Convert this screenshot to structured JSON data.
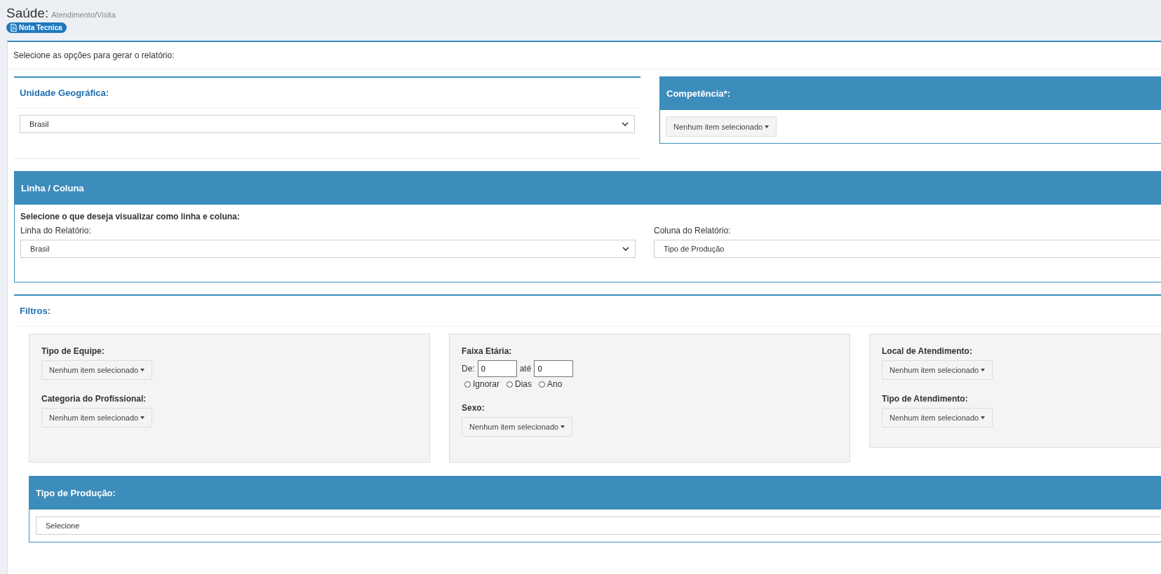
{
  "page_header": {
    "title": "Saúde:",
    "subtitle": "Atendimento/Visita",
    "badge": "Nota Tecnica"
  },
  "intro": "Selecione as opções para gerar o relatório:",
  "unidade": {
    "title": "Unidade Geográfica:",
    "value": "Brasil"
  },
  "competencia": {
    "title": "Competência*:",
    "dropdown": "Nenhum item selecionado"
  },
  "linha_coluna": {
    "title": "Linha / Coluna",
    "instruction": "Selecione o que deseja visualizar como linha e coluna:",
    "linha_label": "Linha do Relatório:",
    "linha_value": "Brasil",
    "coluna_label": "Coluna do Relatório:",
    "coluna_value": "Tipo de Produção"
  },
  "filtros": {
    "title": "Filtros:",
    "groups": [
      {
        "fields": [
          {
            "kind": "dropdown",
            "label": "Tipo de Equipe:",
            "value": "Nenhum item selecionado"
          },
          {
            "kind": "dropdown",
            "label": "Categoria do Profissional:",
            "value": "Nenhum item selecionado"
          }
        ]
      },
      {
        "fields": [
          {
            "kind": "age",
            "label": "Faixa Etária:",
            "from_label": "De:",
            "from_value": "0",
            "to_label": "até",
            "to_value": "0",
            "options": [
              {
                "label": "Ignorar",
                "selected": false
              },
              {
                "label": "Dias",
                "selected": false
              },
              {
                "label": "Ano",
                "selected": false
              }
            ]
          },
          {
            "kind": "dropdown",
            "label": "Sexo:",
            "value": "Nenhum item selecionado"
          }
        ]
      },
      {
        "fields": [
          {
            "kind": "dropdown",
            "label": "Local de Atendimento:",
            "value": "Nenhum item selecionado"
          },
          {
            "kind": "dropdown",
            "label": "Tipo de Atendimento:",
            "value": "Nenhum item selecionado"
          }
        ]
      }
    ]
  },
  "tipo_producao": {
    "title": "Tipo de Produção:",
    "value": "Selecione"
  }
}
